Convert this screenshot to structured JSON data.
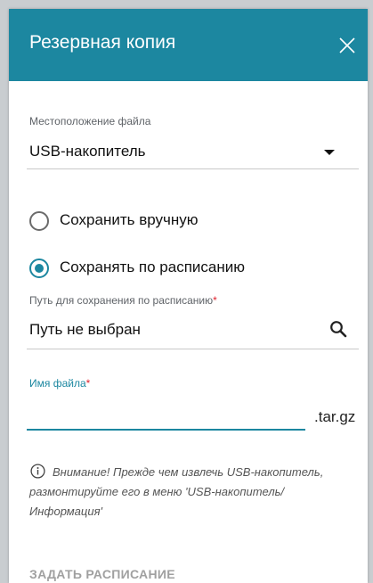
{
  "dialog": {
    "title": "Резервная копия",
    "close_icon": "close-icon"
  },
  "file_location": {
    "label": "Местоположение файла",
    "selected": "USB-накопитель"
  },
  "save_mode": {
    "options": [
      {
        "label": "Сохранить вручную",
        "selected": false
      },
      {
        "label": "Сохранять по расписанию",
        "selected": true
      }
    ]
  },
  "schedule_path": {
    "label": "Путь для сохранения по расписанию",
    "required_mark": "*",
    "value": "Путь не выбран",
    "icon": "search-icon"
  },
  "file_name": {
    "label": "Имя файла",
    "required_mark": "*",
    "value": "",
    "extension": ".tar.gz"
  },
  "notice": {
    "icon": "info-icon",
    "text": "Внимание! Прежде чем извлечь USB-накопитель, размонтируйте его в меню 'USB-накопитель/ Информация'"
  },
  "actions": {
    "set_schedule_label": "ЗАДАТЬ РАСПИСАНИЕ"
  },
  "colors": {
    "accent": "#1c87a0",
    "required": "#e0232f",
    "disabled_text": "#a0a0a0"
  }
}
